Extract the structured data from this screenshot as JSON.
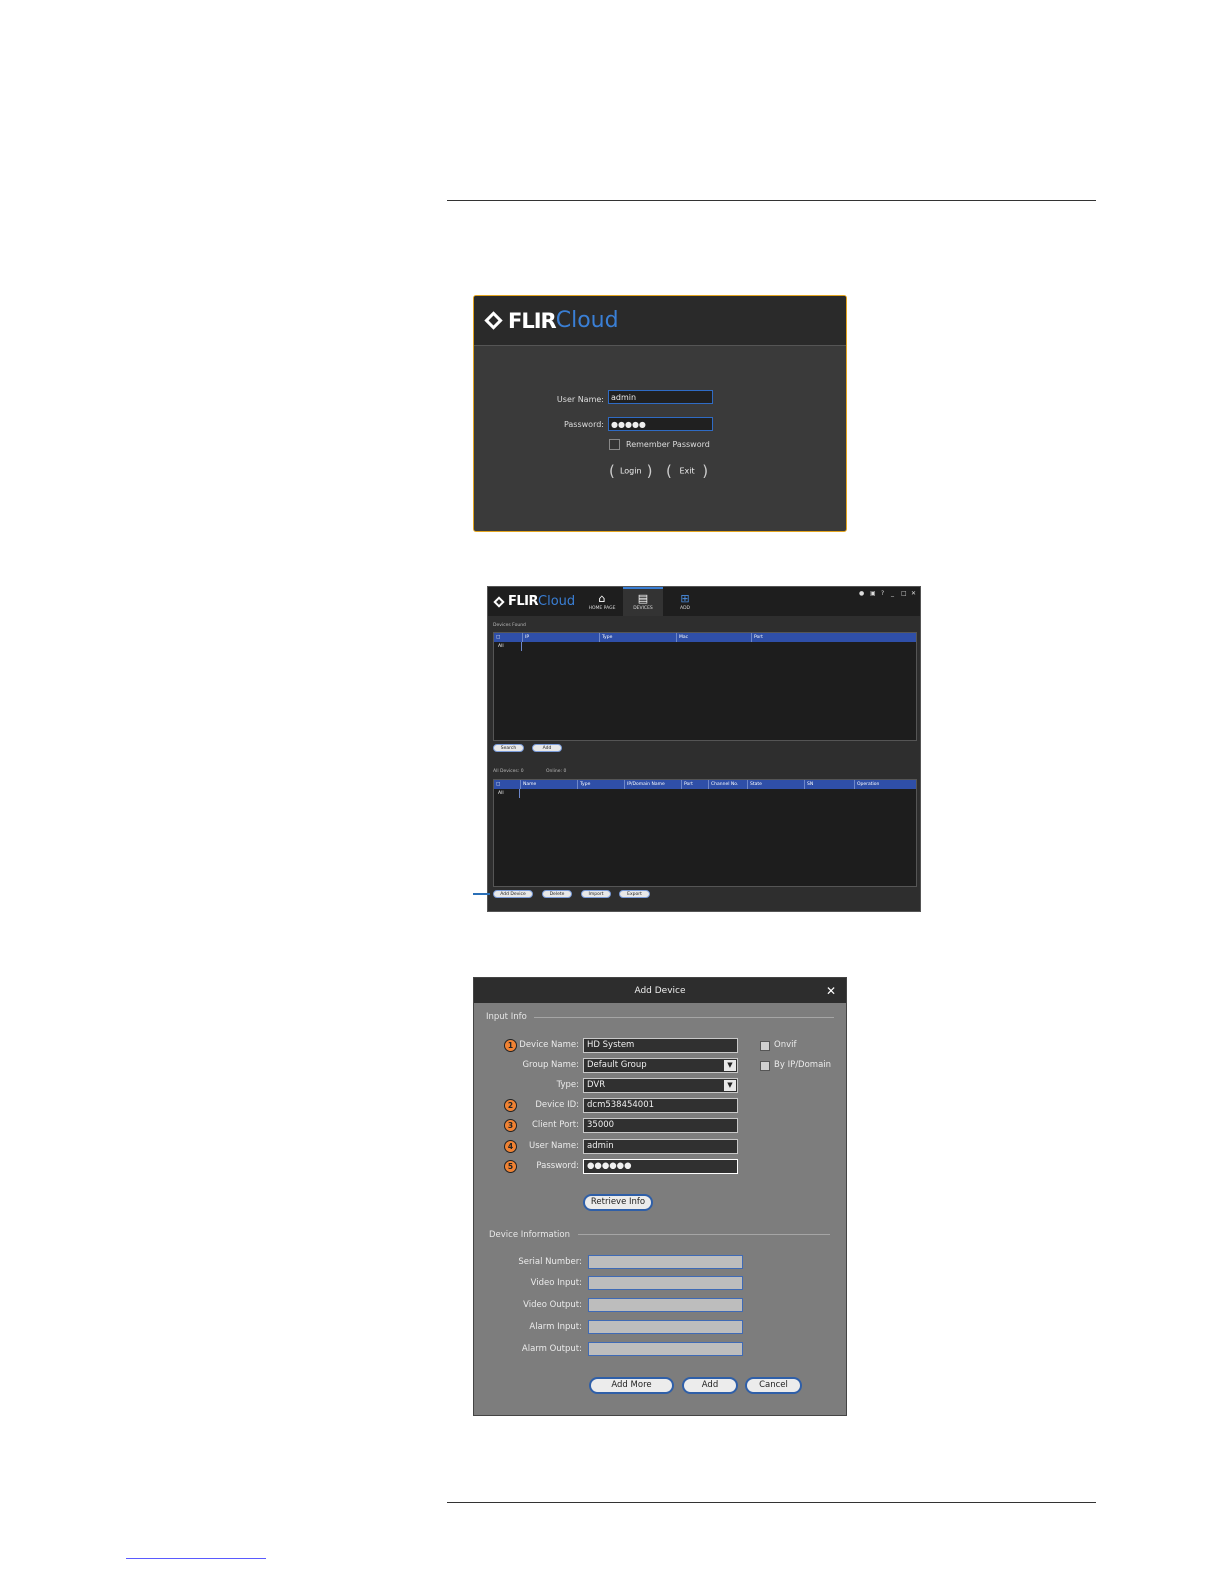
{
  "login_window": {
    "logo_word1": "FLIR",
    "logo_word2": "Cloud",
    "username_label": "User Name:",
    "username_value": "admin",
    "password_label": "Password:",
    "password_value": "●●●●●",
    "remember_label": "Remember Password",
    "login_button": "Login",
    "exit_button": "Exit"
  },
  "devices_window": {
    "logo_word1": "FLIR",
    "logo_word2": "Cloud",
    "nav": [
      {
        "label": "HOME PAGE",
        "icon": "home-icon"
      },
      {
        "label": "DEVICES",
        "icon": "devices-icon"
      },
      {
        "label": "ADD",
        "icon": "add-icon"
      }
    ],
    "found_title": "Devices Found",
    "found_columns": [
      "All",
      "IP",
      "Type",
      "Mac",
      "Port"
    ],
    "search_button": "Search",
    "add_button": "Add",
    "all_devices_label": "All Devices: 0",
    "online_label": "Online: 0",
    "list_columns": [
      "All",
      "Name",
      "Type",
      "IP/Domain Name",
      "Port",
      "Channel No.",
      "State",
      "SN",
      "Operation"
    ],
    "add_device_button": "Add Device",
    "delete_button": "Delete",
    "import_button": "Import",
    "export_button": "Export"
  },
  "add_device_dialog": {
    "title": "Add Device",
    "input_info_title": "Input Info",
    "device_name_label": "Device Name:",
    "device_name_value": "HD System",
    "group_name_label": "Group Name:",
    "group_name_value": "Default Group",
    "type_label": "Type:",
    "type_value": "DVR",
    "device_id_label": "Device ID:",
    "device_id_value": "dcm538454001",
    "client_port_label": "Client Port:",
    "client_port_value": "35000",
    "user_name_label": "User Name:",
    "user_name_value": "admin",
    "password_label": "Password:",
    "password_value": "●●●●●●",
    "onvif_label": "Onvif",
    "by_ip_label": "By IP/Domain",
    "retrieve_button": "Retrieve Info",
    "device_info_title": "Device Information",
    "serial_label": "Serial Number:",
    "video_input_label": "Video Input:",
    "video_output_label": "Video Output:",
    "alarm_input_label": "Alarm Input:",
    "alarm_output_label": "Alarm Output:",
    "add_more_button": "Add More",
    "add_button": "Add",
    "cancel_button": "Cancel",
    "callouts": [
      "1",
      "2",
      "3",
      "4",
      "5"
    ]
  }
}
